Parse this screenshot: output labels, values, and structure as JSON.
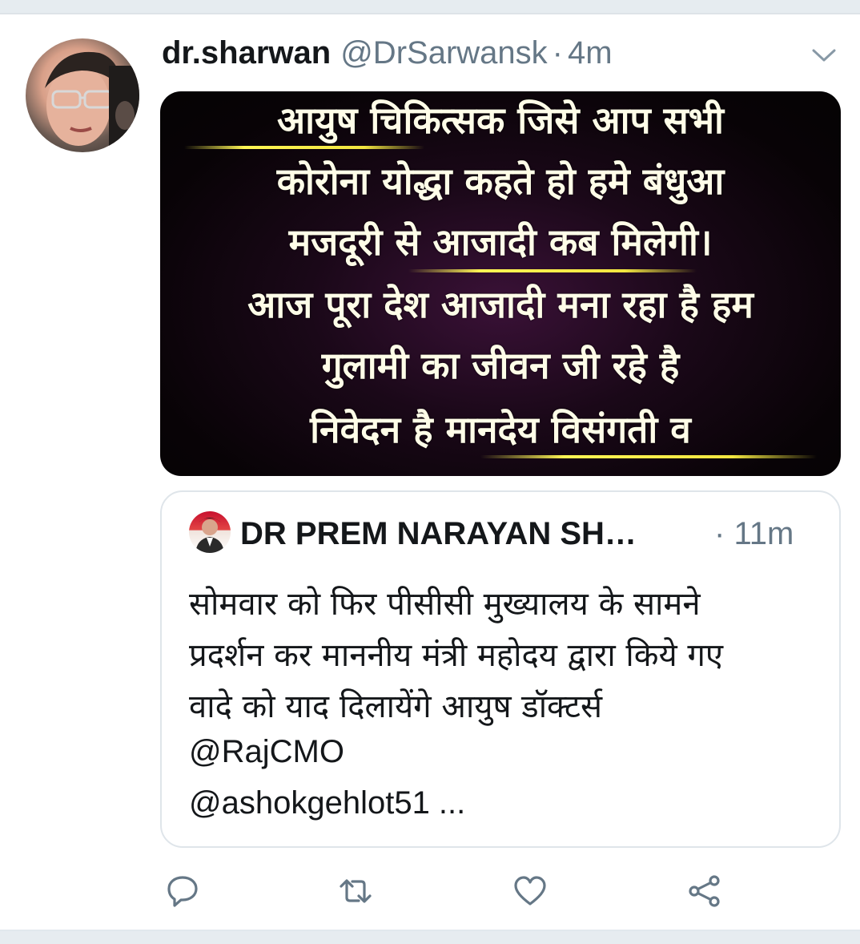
{
  "tweet": {
    "author_name": "dr.sharwan",
    "author_handle": "@DrSarwansk",
    "separator": "·",
    "time": "4m",
    "menu_icon": "chevron-down-icon",
    "avatar": "user-avatar"
  },
  "media": {
    "lines": [
      "आयुष चिकित्सक जिसे आप सभी",
      "कोरोना योद्धा कहते हो हमे बंधुआ",
      "मजदूरी से आजादी कब मिलेगी।",
      "आज पूरा देश आजादी मना रहा है हम",
      "गुलामी का जीवन जी रहे है",
      "निवेदन है मानदेय विसंगती व"
    ],
    "text_color": "#fffde8",
    "highlight_color": "#fff654",
    "background_color": "#1a0818"
  },
  "quoted_tweet": {
    "author_name": "DR PREM NARAYAN SH…",
    "separator": "·",
    "time": "11m",
    "text_lines": [
      "सोमवार को फिर पीसीसी मुख्यालय के सामने",
      "प्रदर्शन कर माननीय मंत्री महोदय द्वारा किये गए",
      "वादे को याद दिलायेंगे आयुष डॉक्टर्स"
    ],
    "mention_1": "@RajCMO",
    "mention_2": "@ashokgehlot51 ..."
  },
  "actions": [
    {
      "name": "reply",
      "icon": "reply-icon"
    },
    {
      "name": "retweet",
      "icon": "retweet-icon"
    },
    {
      "name": "like",
      "icon": "heart-icon"
    },
    {
      "name": "share",
      "icon": "share-icon"
    }
  ],
  "colors": {
    "primary_text": "#14171a",
    "secondary_text": "#657786",
    "border": "#dfe5ea",
    "background_band": "#e6ecf0"
  }
}
